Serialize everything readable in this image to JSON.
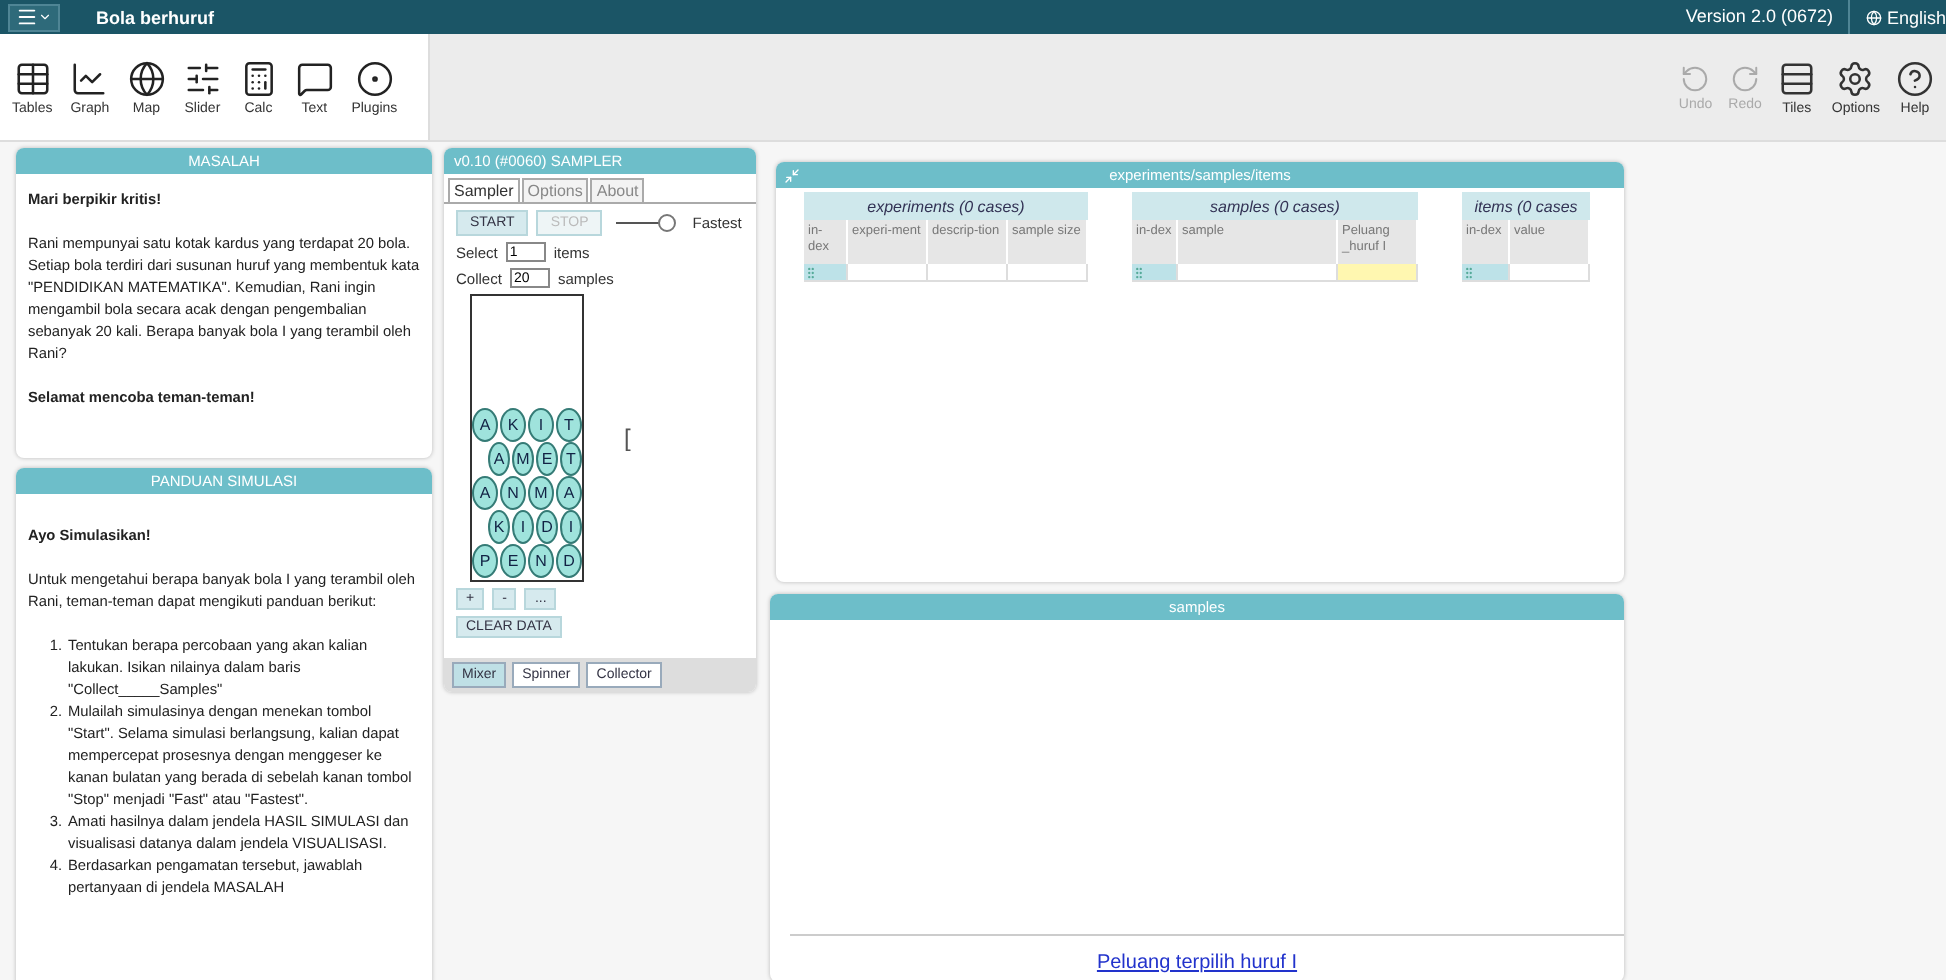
{
  "topbar": {
    "title": "Bola berhuruf",
    "version": "Version 2.0 (0672)",
    "language": "English"
  },
  "toolbar": {
    "tools": [
      {
        "label": "Tables"
      },
      {
        "label": "Graph"
      },
      {
        "label": "Map"
      },
      {
        "label": "Slider"
      },
      {
        "label": "Calc"
      },
      {
        "label": "Text"
      },
      {
        "label": "Plugins"
      }
    ],
    "right_tools": [
      {
        "label": "Undo",
        "disabled": true
      },
      {
        "label": "Redo",
        "disabled": true
      },
      {
        "label": "Tiles",
        "disabled": false
      },
      {
        "label": "Options",
        "disabled": false
      },
      {
        "label": "Help",
        "disabled": false
      }
    ]
  },
  "masalah": {
    "title": "MASALAH",
    "heading": "Mari berpikir kritis!",
    "paragraph": "Rani mempunyai satu kotak kardus yang terdapat 20 bola. Setiap bola terdiri dari susunan huruf yang membentuk kata \"PENDIDIKAN MATEMATIKA\". Kemudian, Rani ingin mengambil bola secara acak dengan pengembalian sebanyak 20 kali. Berapa banyak bola I yang terambil oleh Rani?",
    "closing": "Selamat mencoba teman-teman!"
  },
  "panduan": {
    "title": "PANDUAN SIMULASI",
    "heading": "Ayo Simulasikan!",
    "intro": "Untuk mengetahui berapa banyak bola I yang terambil oleh Rani, teman-teman dapat mengikuti panduan berikut:",
    "steps": [
      {
        "marker": "1.",
        "text": "Tentukan berapa percobaan yang akan kalian lakukan. Isikan nilainya dalam baris \"Collect_____Samples\""
      },
      {
        "marker": "2.",
        "text": "Mulailah simulasinya dengan menekan tombol \"Start\". Selama simulasi berlangsung, kalian dapat mempercepat prosesnya dengan menggeser ke kanan bulatan yang berada di sebelah kanan tombol \"Stop\" menjadi \"Fast\" atau \"Fastest\"."
      },
      {
        "marker": "3.",
        "text": "Amati hasilnya dalam jendela HASIL SIMULASI dan visualisasi datanya dalam jendela VISUALISASI."
      },
      {
        "marker": "4.",
        "text": "Berdasarkan pengamatan tersebut, jawablah pertanyaan di jendela MASALAH"
      }
    ]
  },
  "sampler": {
    "title": "v0.10 (#0060)  SAMPLER",
    "tabs": [
      {
        "label": "Sampler",
        "selected": true
      },
      {
        "label": "Options",
        "selected": false
      },
      {
        "label": "About",
        "selected": false
      }
    ],
    "start": {
      "label": "START",
      "disabled": false
    },
    "stop": {
      "label": "STOP",
      "disabled": true
    },
    "speed": {
      "label": "Fastest",
      "level": 1
    },
    "select": {
      "prefix": "Select",
      "value": "1",
      "suffix": "items"
    },
    "collect": {
      "prefix": "Collect",
      "value": "20",
      "suffix": "samples"
    },
    "balls": [
      [
        "A",
        "K",
        "I",
        "T"
      ],
      [
        "A",
        "M",
        "E",
        "T"
      ],
      [
        "A",
        "N",
        "M",
        "A"
      ],
      [
        "K",
        "I",
        "D",
        "I"
      ],
      [
        "P",
        "E",
        "N",
        "D"
      ]
    ],
    "bracket": "[",
    "edit_buttons": [
      "+",
      "-",
      "..."
    ],
    "clear": "CLEAR DATA",
    "devices": [
      {
        "label": "Mixer",
        "selected": true
      },
      {
        "label": "Spinner",
        "selected": false
      },
      {
        "label": "Collector",
        "selected": false
      }
    ]
  },
  "table": {
    "title": "experiments/samples/items",
    "collections": [
      {
        "title": "experiments (0 cases)",
        "columns": [
          {
            "label": "in-dex",
            "highlighted": false
          },
          {
            "label": "experi-ment",
            "highlighted": false
          },
          {
            "label": "descrip-tion",
            "highlighted": false
          },
          {
            "label": "sample size",
            "highlighted": false
          }
        ]
      },
      {
        "title": "samples (0 cases)",
        "columns": [
          {
            "label": "in-dex",
            "highlighted": false
          },
          {
            "label": "sample",
            "highlighted": false
          },
          {
            "label": "Peluang _huruf I",
            "highlighted": true
          }
        ]
      },
      {
        "title": "items (0 cases",
        "columns": [
          {
            "label": "in-dex",
            "highlighted": false
          },
          {
            "label": "value",
            "highlighted": false
          }
        ]
      }
    ]
  },
  "graph": {
    "title": "samples",
    "link": "Peluang terpilih huruf I"
  }
}
